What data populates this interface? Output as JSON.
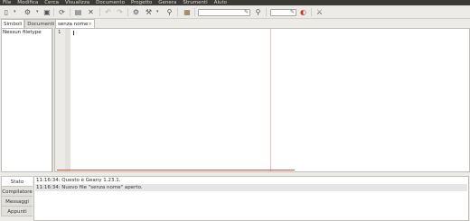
{
  "menu": [
    "File",
    "Modifica",
    "Cerca",
    "Visualizza",
    "Documento",
    "Progetto",
    "Genera",
    "Strumenti",
    "Aiuto"
  ],
  "toolbar": {
    "icons": [
      "new-file-icon",
      "open-file-icon",
      "save-icon",
      "save-all-icon",
      "revert-icon",
      "close-file-icon",
      "undo-icon",
      "redo-icon",
      "compile-icon",
      "build-icon",
      "run-icon",
      "color-chooser-icon",
      "zoom-icon",
      "jump-to-line-icon",
      "quit-icon"
    ],
    "search_value": "",
    "goto_value": ""
  },
  "sidebar": {
    "tabs": [
      "Simboli",
      "Documenti"
    ],
    "panel_text": "Nessun filetype"
  },
  "editor": {
    "tab_label": "senza nome",
    "tab_close": "×",
    "line_number": "1"
  },
  "messages": {
    "tabs": [
      "Stato",
      "Compilatore",
      "Messaggi",
      "Appunti"
    ],
    "lines": [
      "11:16:34: Questo è Geany 1.23.1.",
      "11:16:34: Nuovo file \"senza nome\" aperto."
    ]
  },
  "colors": {
    "menubar_bg": "#3c3b37",
    "window_bg": "#ecebe8",
    "caret_line_marker": "#e0503a"
  }
}
